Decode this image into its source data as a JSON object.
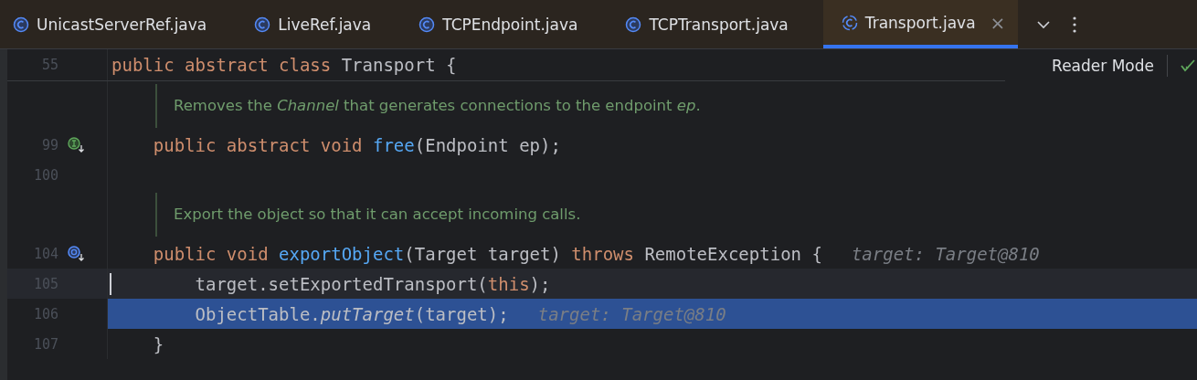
{
  "tabs": [
    {
      "label": "UnicastServerRef.java",
      "selected": false
    },
    {
      "label": "LiveRef.java",
      "selected": false
    },
    {
      "label": "TCPEndpoint.java",
      "selected": false
    },
    {
      "label": "TCPTransport.java",
      "selected": false
    },
    {
      "label": "Transport.java",
      "selected": true,
      "close": "×"
    }
  ],
  "sticky_line": {
    "number": "55",
    "tokens": [
      {
        "kind": "keyword",
        "text": "public abstract class "
      },
      {
        "kind": "plain",
        "text": "Transport {"
      }
    ]
  },
  "reader_mode": "Reader Mode",
  "lines": [
    {
      "kind": "doc",
      "text": "Removes the *Channel* that generates connections to the endpoint *ep*."
    },
    {
      "kind": "code",
      "number": "99",
      "gutter_icon": {
        "kind": "implemented"
      },
      "current": false,
      "selected": false,
      "tokens": [
        {
          "kind": "keyword",
          "text": "    public abstract void "
        },
        {
          "kind": "method",
          "text": "free"
        },
        {
          "kind": "plain",
          "text": "(Endpoint ep);"
        }
      ]
    },
    {
      "kind": "code",
      "number": "100",
      "current": false,
      "selected": false
    },
    {
      "kind": "doc",
      "text": "Export the object so that it can accept incoming calls."
    },
    {
      "kind": "code",
      "number": "104",
      "gutter_icon": {
        "kind": "overridden"
      },
      "current": false,
      "selected": false,
      "tokens": [
        {
          "kind": "keyword",
          "text": "    public void "
        },
        {
          "kind": "method",
          "text": "exportObject"
        },
        {
          "kind": "plain",
          "text": "(Target target) "
        },
        {
          "kind": "keyword",
          "text": "throws"
        },
        {
          "kind": "plain",
          "text": " RemoteException {"
        },
        {
          "kind": "hint",
          "text": "target: Target@810"
        }
      ]
    },
    {
      "kind": "code",
      "number": "105",
      "current": true,
      "selected": false,
      "tokens": [
        {
          "kind": "plain",
          "text": "        target.setExportedTransport("
        },
        {
          "kind": "keyword",
          "text": "this"
        },
        {
          "kind": "plain",
          "text": ");"
        }
      ]
    },
    {
      "kind": "code",
      "number": "106",
      "current": false,
      "selected": true,
      "tokens": [
        {
          "kind": "plain",
          "text": "        ObjectTable."
        },
        {
          "kind": "static",
          "text": "putTarget"
        },
        {
          "kind": "plain",
          "text": "(target);"
        },
        {
          "kind": "hint",
          "text": "target: Target@810"
        }
      ]
    },
    {
      "kind": "code",
      "number": "107",
      "current": false,
      "selected": false,
      "tokens": [
        {
          "kind": "plain",
          "text": "    }"
        }
      ]
    }
  ]
}
